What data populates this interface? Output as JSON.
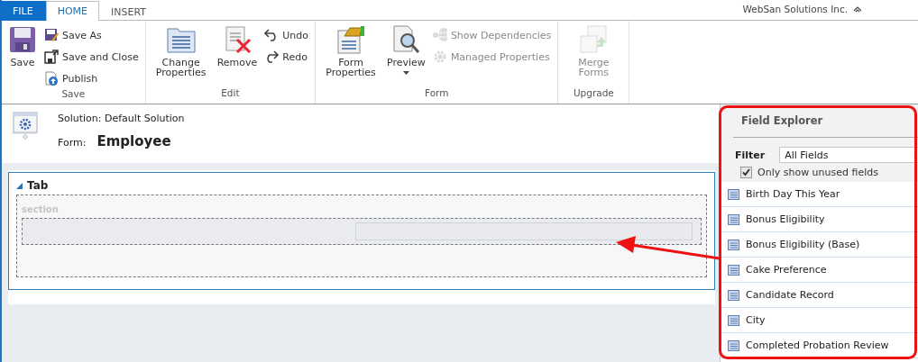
{
  "ribbon": {
    "tabs": [
      {
        "label": "FILE",
        "kind": "file",
        "selected": false
      },
      {
        "label": "HOME",
        "kind": "tab",
        "selected": true
      },
      {
        "label": "INSERT",
        "kind": "tab",
        "selected": false
      }
    ],
    "organization": "WebSan Solutions Inc.",
    "groups": [
      {
        "label": "Save",
        "items": [
          {
            "kind": "large",
            "label": "Save",
            "disabled": false
          },
          {
            "kind": "stack",
            "buttons": [
              {
                "label": "Save As",
                "disabled": false
              },
              {
                "label": "Save and Close",
                "disabled": false
              },
              {
                "label": "Publish",
                "disabled": false
              }
            ]
          }
        ]
      },
      {
        "label": "Edit",
        "items": [
          {
            "kind": "large",
            "label": "Change Properties",
            "disabled": false
          },
          {
            "kind": "large",
            "label": "Remove",
            "disabled": false
          },
          {
            "kind": "stack",
            "buttons": [
              {
                "label": "Undo",
                "disabled": false
              },
              {
                "label": "Redo",
                "disabled": false
              }
            ]
          }
        ]
      },
      {
        "label": "Form",
        "items": [
          {
            "kind": "large",
            "label": "Form Properties",
            "disabled": false
          },
          {
            "kind": "dropdown",
            "label": "Preview",
            "disabled": false
          },
          {
            "kind": "stack",
            "buttons": [
              {
                "label": "Show Dependencies",
                "disabled": true
              },
              {
                "label": "Managed Properties",
                "disabled": true
              }
            ]
          }
        ]
      },
      {
        "label": "Upgrade",
        "items": [
          {
            "kind": "large",
            "label": "Merge Forms",
            "disabled": true
          }
        ]
      }
    ]
  },
  "form_header": {
    "solution": "Solution: Default Solution",
    "form_label": "Form:",
    "form_name": "Employee"
  },
  "canvas": {
    "tab": {
      "label": "Tab",
      "expanded": true
    },
    "section": {
      "label": "section"
    }
  },
  "field_explorer": {
    "title": "Field Explorer",
    "filter_label": "Filter",
    "filter_value": "All Fields",
    "unused_only": {
      "label": "Only show unused fields",
      "checked": true
    },
    "fields": [
      "Birth Day This Year",
      "Bonus Eligibility",
      "Bonus Eligibility (Base)",
      "Cake Preference",
      "Candidate Record",
      "City",
      "Completed Probation Review"
    ]
  }
}
